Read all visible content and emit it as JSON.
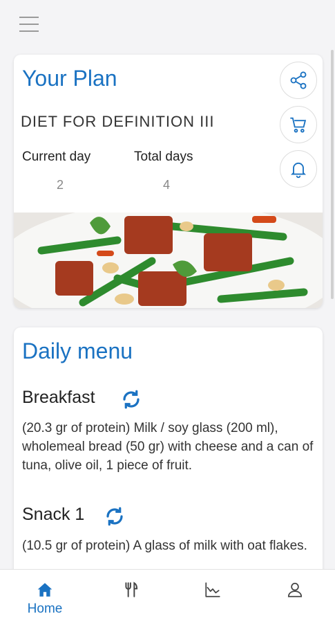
{
  "plan": {
    "title": "Your Plan",
    "name": "DIET FOR DEFINITION III",
    "current_day_label": "Current day",
    "current_day_value": "2",
    "total_days_label": "Total days",
    "total_days_value": "4",
    "actions": [
      "share-icon",
      "cart-icon",
      "bell-icon"
    ]
  },
  "menu": {
    "title": "Daily menu",
    "meals": [
      {
        "name": "Breakfast",
        "description": "(20.3 gr of protein) Milk / soy glass (200 ml), wholemeal bread (50 gr) with cheese and a can of tuna, olive oil, 1 piece of fruit."
      },
      {
        "name": "Snack 1",
        "description": "(10.5 gr of protein) A glass of milk with oat flakes."
      }
    ]
  },
  "nav": {
    "items": [
      {
        "icon": "home-icon",
        "label": "Home",
        "active": true
      },
      {
        "icon": "fork-knife-icon",
        "label": ""
      },
      {
        "icon": "chart-icon",
        "label": ""
      },
      {
        "icon": "profile-icon",
        "label": ""
      }
    ]
  },
  "colors": {
    "accent": "#1a72c2",
    "background": "#f4f4f6",
    "card": "#ffffff"
  }
}
